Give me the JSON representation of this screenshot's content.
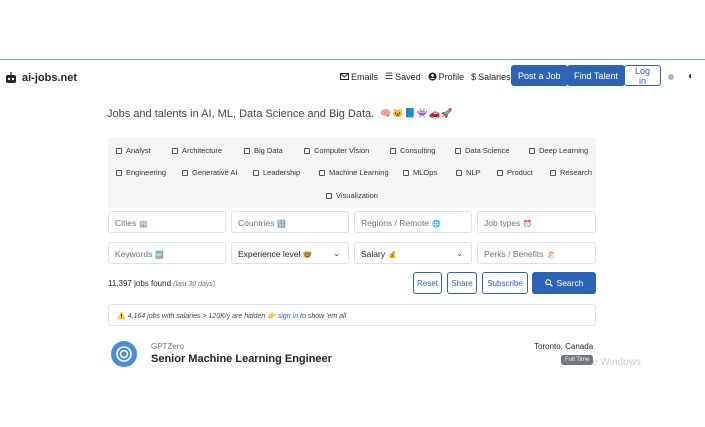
{
  "brand": {
    "name": "ai-jobs.net"
  },
  "nav": {
    "emails": "Emails",
    "saved": "Saved",
    "profile": "Profile",
    "salaries": "Salaries",
    "post_job": "Post a Job",
    "find_talent": "Find Talent",
    "login": "Log in"
  },
  "tagline": {
    "text": "Jobs and talents in AI, ML, Data Science and Big Data.",
    "emojis": "🧠🐱📘👾🚗🚀"
  },
  "categories": [
    "Analyst",
    "Architecture",
    "Big Data",
    "Computer Vision",
    "Consulting",
    "Data Science",
    "Deep Learning",
    "Engineering",
    "Generative AI",
    "Leadership",
    "Machine Learning",
    "MLOps",
    "NLP",
    "Product",
    "Research",
    "Visualization"
  ],
  "filters": {
    "cities": "Cities",
    "countries": "Countries",
    "regions": "Regions / Remote",
    "job_types": "Job types",
    "keywords": "Keywords",
    "experience": "Experience level",
    "salary": "Salary",
    "perks": "Perks / Benefits"
  },
  "results": {
    "count_text": "11,397 jobs found",
    "period": "(last 30 days)"
  },
  "actions": {
    "reset": "Reset",
    "share": "Share",
    "subscribe": "Subscribe",
    "search": "Search"
  },
  "alert": {
    "prefix": "4,164 jobs with salaries > 120K/y are hidden 👉",
    "link": "sign in",
    "suffix": "to show 'em all"
  },
  "job": {
    "company": "GPTZero",
    "title": "Senior Machine Learning Engineer",
    "location": "Toronto, Canada",
    "type": "Full Time"
  },
  "watermark": "Activate Windows",
  "colors": {
    "primary": "#2e64b8",
    "logo": "#4a8fd6"
  }
}
